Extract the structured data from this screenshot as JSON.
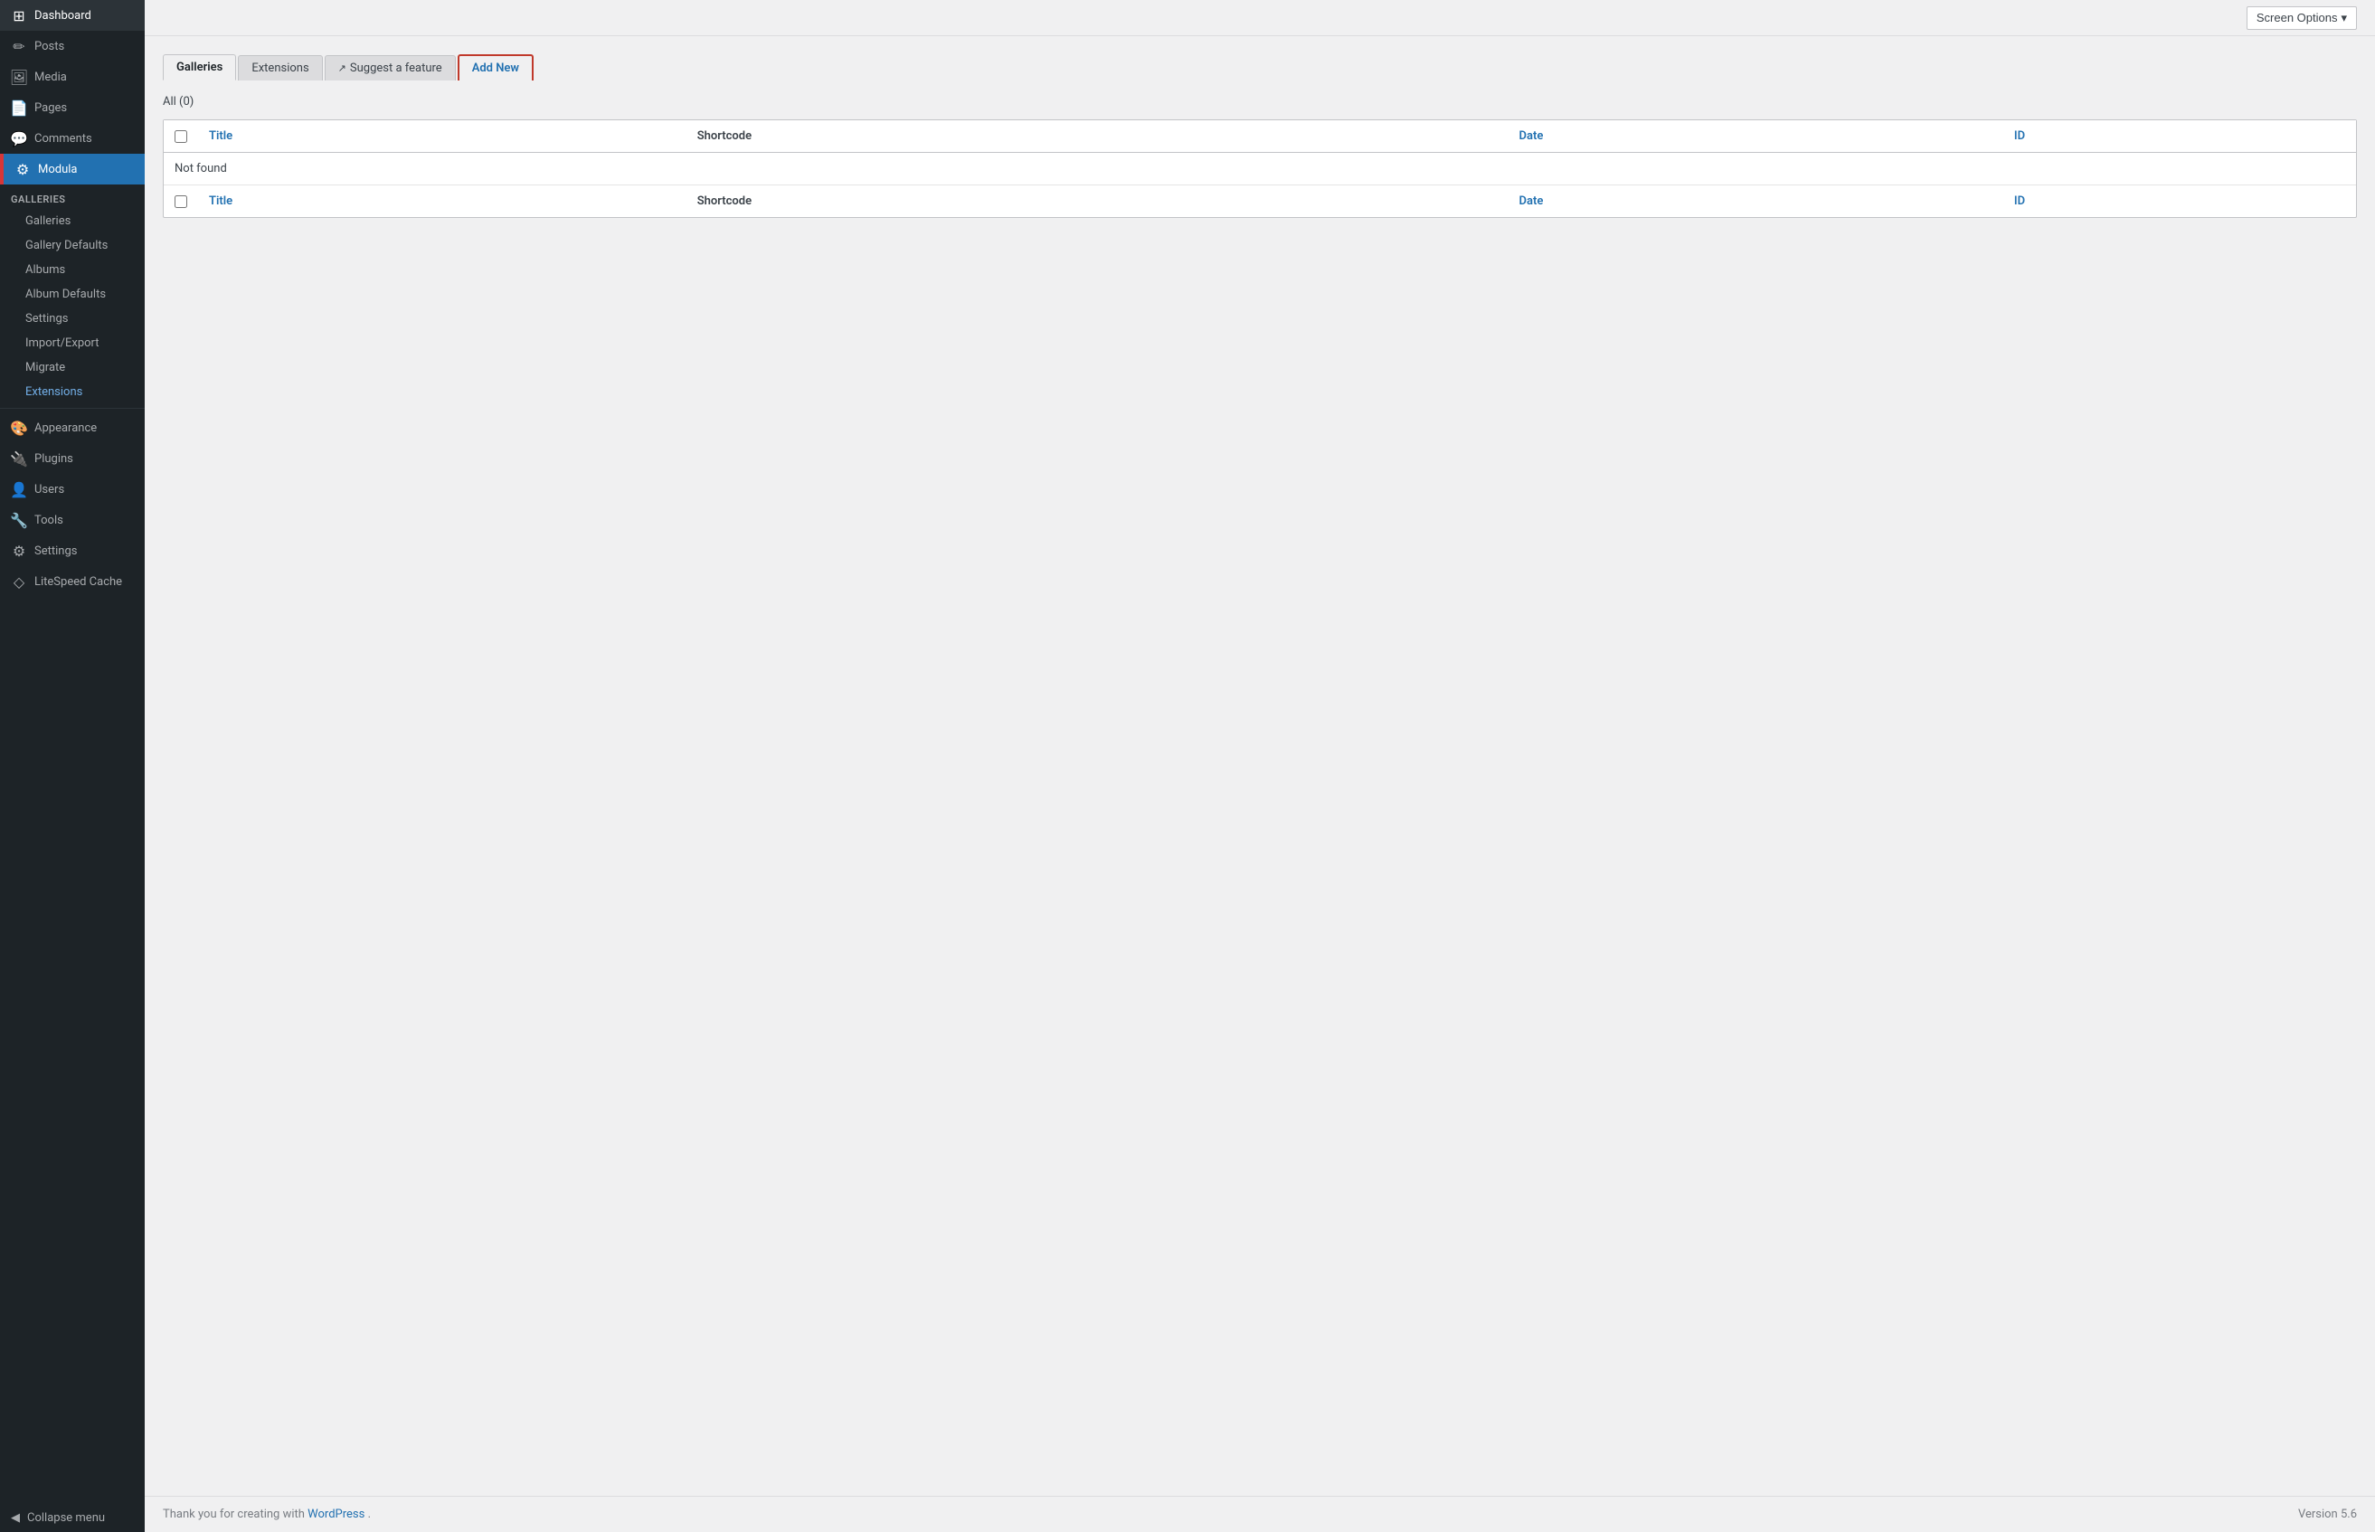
{
  "sidebar": {
    "items": [
      {
        "id": "dashboard",
        "label": "Dashboard",
        "icon": "⊞",
        "active": false
      },
      {
        "id": "posts",
        "label": "Posts",
        "icon": "📝",
        "active": false
      },
      {
        "id": "media",
        "label": "Media",
        "icon": "🖼",
        "active": false
      },
      {
        "id": "pages",
        "label": "Pages",
        "icon": "📄",
        "active": false
      },
      {
        "id": "comments",
        "label": "Comments",
        "icon": "💬",
        "active": false
      },
      {
        "id": "modula",
        "label": "Modula",
        "icon": "⚙",
        "active": true
      }
    ],
    "modula_submenu": {
      "section_label": "Galleries",
      "items": [
        {
          "id": "galleries",
          "label": "Galleries",
          "active": false
        },
        {
          "id": "gallery-defaults",
          "label": "Gallery Defaults",
          "active": false
        },
        {
          "id": "albums",
          "label": "Albums",
          "active": false
        },
        {
          "id": "album-defaults",
          "label": "Album Defaults",
          "active": false
        },
        {
          "id": "settings",
          "label": "Settings",
          "active": false
        },
        {
          "id": "import-export",
          "label": "Import/Export",
          "active": false
        },
        {
          "id": "migrate",
          "label": "Migrate",
          "active": false
        },
        {
          "id": "extensions",
          "label": "Extensions",
          "active": true
        }
      ]
    },
    "bottom_items": [
      {
        "id": "appearance",
        "label": "Appearance",
        "icon": "🎨"
      },
      {
        "id": "plugins",
        "label": "Plugins",
        "icon": "🔌"
      },
      {
        "id": "users",
        "label": "Users",
        "icon": "👤"
      },
      {
        "id": "tools",
        "label": "Tools",
        "icon": "🔧"
      },
      {
        "id": "settings",
        "label": "Settings",
        "icon": "⚙"
      },
      {
        "id": "litespeed-cache",
        "label": "LiteSpeed Cache",
        "icon": "◇"
      }
    ],
    "collapse_label": "Collapse menu"
  },
  "topbar": {
    "screen_options_label": "Screen Options",
    "screen_options_arrow": "▾"
  },
  "tabs": [
    {
      "id": "galleries",
      "label": "Galleries",
      "active": true
    },
    {
      "id": "extensions",
      "label": "Extensions",
      "active": false
    },
    {
      "id": "suggest",
      "label": "Suggest a feature",
      "active": false,
      "external": true
    },
    {
      "id": "add-new",
      "label": "Add New",
      "active": false
    }
  ],
  "filter": {
    "all_label": "All",
    "count": "(0)"
  },
  "table": {
    "columns": [
      {
        "id": "title",
        "label": "Title",
        "link": true
      },
      {
        "id": "shortcode",
        "label": "Shortcode",
        "link": false
      },
      {
        "id": "date",
        "label": "Date",
        "link": true
      },
      {
        "id": "id",
        "label": "ID",
        "link": true
      }
    ],
    "rows": [
      {
        "message": "Not found"
      }
    ]
  },
  "footer": {
    "thank_you_text": "Thank you for creating with ",
    "wordpress_link_text": "WordPress",
    "version_label": "Version 5.6"
  }
}
